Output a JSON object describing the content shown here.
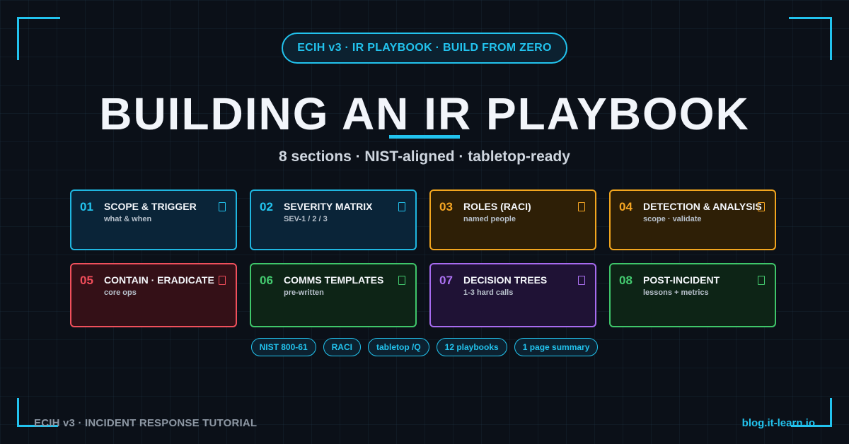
{
  "header": {
    "pill": "ECIH v3 · IR PLAYBOOK · BUILD FROM ZERO",
    "title": "BUILDING AN IR PLAYBOOK",
    "subtitle": "8 sections · NIST-aligned · tabletop-ready"
  },
  "colors": {
    "accent": "#22c3ee",
    "blue": "#22c3ee",
    "orange": "#f6a623",
    "red": "#f04d5a",
    "green": "#44cc70",
    "purple": "#ad72f4",
    "background": "#0b1018"
  },
  "cards": [
    {
      "num": "01",
      "title": "SCOPE & TRIGGER",
      "sub": "what & when",
      "color": "blue",
      "icon": "document-icon"
    },
    {
      "num": "02",
      "title": "SEVERITY MATRIX",
      "sub": "SEV-1 / 2 / 3",
      "color": "blue",
      "icon": "document-icon"
    },
    {
      "num": "03",
      "title": "ROLES (RACI)",
      "sub": "named people",
      "color": "orange",
      "icon": "document-icon"
    },
    {
      "num": "04",
      "title": "DETECTION & ANALYSIS",
      "sub": "scope · validate",
      "color": "orange",
      "icon": "document-icon"
    },
    {
      "num": "05",
      "title": "CONTAIN · ERADICATE",
      "sub": "core ops",
      "color": "red",
      "icon": "document-icon"
    },
    {
      "num": "06",
      "title": "COMMS TEMPLATES",
      "sub": "pre-written",
      "color": "green",
      "icon": "document-icon"
    },
    {
      "num": "07",
      "title": "DECISION TREES",
      "sub": "1-3 hard calls",
      "color": "purple",
      "icon": "document-icon"
    },
    {
      "num": "08",
      "title": "POST-INCIDENT",
      "sub": "lessons + metrics",
      "color": "green",
      "icon": "document-icon"
    }
  ],
  "tags": [
    "NIST 800-61",
    "RACI",
    "tabletop /Q",
    "12 playbooks",
    "1 page summary"
  ],
  "footer": {
    "left": "ECIH v3 · INCIDENT RESPONSE TUTORIAL",
    "right": "blog.it-learn.io"
  }
}
